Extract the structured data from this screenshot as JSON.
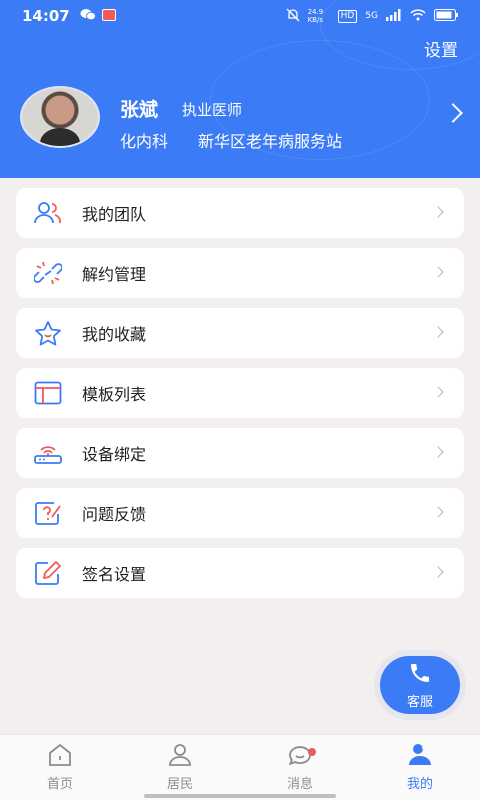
{
  "status_bar": {
    "time": "14:07",
    "network_label": "5G",
    "hd_label": "HD",
    "speed_text": "24.9 KB/s"
  },
  "header": {
    "settings_label": "设置",
    "doctor_name": "张斌",
    "doctor_title": "执业医师",
    "department": "化内科",
    "station": "新华区老年病服务站"
  },
  "menu": {
    "items": [
      {
        "label": "我的团队",
        "icon": "team-icon"
      },
      {
        "label": "解约管理",
        "icon": "broken-link-icon"
      },
      {
        "label": "我的收藏",
        "icon": "star-icon"
      },
      {
        "label": "模板列表",
        "icon": "template-icon"
      },
      {
        "label": "设备绑定",
        "icon": "router-icon"
      },
      {
        "label": "问题反馈",
        "icon": "feedback-icon"
      },
      {
        "label": "签名设置",
        "icon": "sign-icon"
      }
    ]
  },
  "service": {
    "label": "客服",
    "icon": "phone-icon"
  },
  "tabs": [
    {
      "label": "首页",
      "icon": "home-icon",
      "active": false
    },
    {
      "label": "居民",
      "icon": "user-icon",
      "active": false
    },
    {
      "label": "消息",
      "icon": "message-icon",
      "active": false,
      "badge": true
    },
    {
      "label": "我的",
      "icon": "profile-icon",
      "active": true
    }
  ],
  "colors": {
    "primary": "#3b7bf6",
    "icon_blue": "#3b7bf6",
    "icon_red": "#f05a5a",
    "background": "#f4efef"
  }
}
